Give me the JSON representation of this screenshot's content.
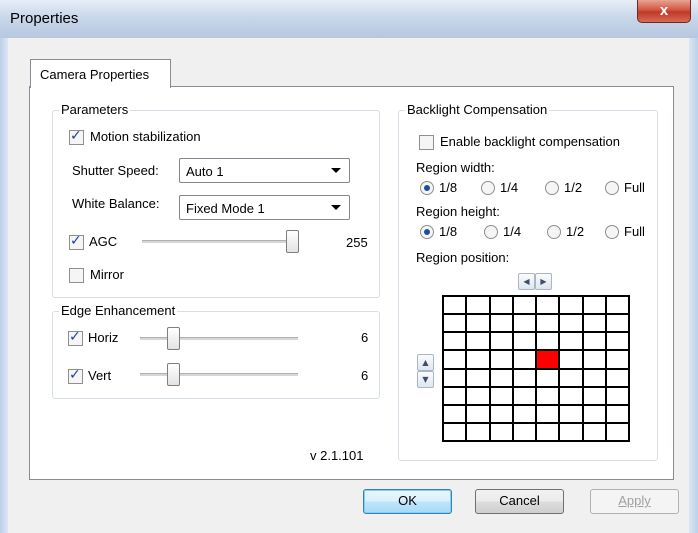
{
  "window": {
    "title": "Properties",
    "close_label": "x"
  },
  "tabs": [
    {
      "label": "Camera Properties"
    }
  ],
  "parameters": {
    "title": "Parameters",
    "motion_stabilization": {
      "label": "Motion stabilization",
      "checked": true
    },
    "shutter_speed": {
      "label": "Shutter Speed:",
      "value": "Auto 1"
    },
    "white_balance": {
      "label": "White Balance:",
      "value": "Fixed Mode 1"
    },
    "agc": {
      "label": "AGC",
      "checked": true,
      "value": "255"
    },
    "mirror": {
      "label": "Mirror",
      "checked": false
    }
  },
  "edge_enhancement": {
    "title": "Edge Enhancement",
    "horiz": {
      "label": "Horiz",
      "checked": true,
      "value": "6"
    },
    "vert": {
      "label": "Vert",
      "checked": true,
      "value": "6"
    }
  },
  "version": "v 2.1.101",
  "backlight": {
    "title": "Backlight Compensation",
    "enable": {
      "label": "Enable backlight compensation",
      "checked": false
    },
    "region_width": {
      "label": "Region width:",
      "options": [
        "1/8",
        "1/4",
        "1/2",
        "Full"
      ],
      "selected": "1/8"
    },
    "region_height": {
      "label": "Region height:",
      "options": [
        "1/8",
        "1/4",
        "1/2",
        "Full"
      ],
      "selected": "1/8"
    },
    "region_position": {
      "label": "Region position:",
      "grid_cols": 8,
      "grid_rows": 8,
      "selected_col": 4,
      "selected_row": 3
    }
  },
  "buttons": {
    "ok": "OK",
    "cancel": "Cancel",
    "apply": "Apply"
  },
  "colors": {
    "selected_region": "#ff0000",
    "default_button_border": "#3c7fb1"
  }
}
